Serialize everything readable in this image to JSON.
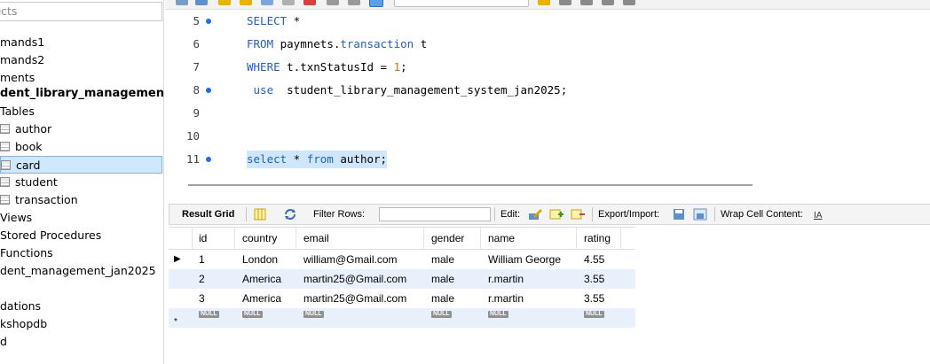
{
  "sidebar": {
    "filter_text": "jects",
    "rows": [
      {
        "label": "mands1",
        "icon": "",
        "style": "normal"
      },
      {
        "label": "mands2",
        "icon": "",
        "style": "normal"
      },
      {
        "label": "ments",
        "icon": "",
        "style": "normal"
      },
      {
        "label": "dent_library_management",
        "icon": "",
        "style": "bold"
      },
      {
        "label": "Tables",
        "icon": "",
        "style": "normal"
      },
      {
        "label": "author",
        "icon": "table-icon",
        "style": "normal"
      },
      {
        "label": "book",
        "icon": "table-icon",
        "style": "normal"
      },
      {
        "label": "card",
        "icon": "table-icon",
        "style": "selected"
      },
      {
        "label": "student",
        "icon": "table-icon",
        "style": "normal"
      },
      {
        "label": "transaction",
        "icon": "table-icon",
        "style": "normal"
      },
      {
        "label": "Views",
        "icon": "",
        "style": "normal"
      },
      {
        "label": "Stored Procedures",
        "icon": "",
        "style": "normal"
      },
      {
        "label": "Functions",
        "icon": "",
        "style": "normal"
      },
      {
        "label": "dent_management_jan2025",
        "icon": "",
        "style": "normal"
      },
      {
        "label": "",
        "icon": "",
        "style": "normal"
      },
      {
        "label": "dations",
        "icon": "",
        "style": "normal"
      },
      {
        "label": "kshopdb",
        "icon": "",
        "style": "normal"
      },
      {
        "label": "d",
        "icon": "",
        "style": "normal"
      }
    ]
  },
  "editor": {
    "lines": [
      {
        "num": "5",
        "dot": true,
        "tokens": [
          {
            "t": "SELECT",
            "c": "kw"
          },
          {
            "t": " *",
            "c": ""
          }
        ]
      },
      {
        "num": "6",
        "dot": false,
        "tokens": [
          {
            "t": "FROM",
            "c": "kw"
          },
          {
            "t": " paymnets.",
            "c": ""
          },
          {
            "t": "transaction",
            "c": "kw"
          },
          {
            "t": " t",
            "c": ""
          }
        ]
      },
      {
        "num": "7",
        "dot": false,
        "tokens": [
          {
            "t": "WHERE",
            "c": "kw"
          },
          {
            "t": " t.txnStatusId = ",
            "c": ""
          },
          {
            "t": "1",
            "c": "num"
          },
          {
            "t": ";",
            "c": ""
          }
        ]
      },
      {
        "num": "8",
        "dot": true,
        "tokens": [
          {
            "t": " use",
            "c": "kw"
          },
          {
            "t": "  student_library_management_system_jan2025;",
            "c": ""
          }
        ]
      },
      {
        "num": "9",
        "dot": false,
        "tokens": []
      },
      {
        "num": "10",
        "dot": false,
        "tokens": []
      },
      {
        "num": "11",
        "dot": true,
        "highlight": true,
        "tokens": [
          {
            "t": "select",
            "c": "kw"
          },
          {
            "t": " * ",
            "c": ""
          },
          {
            "t": "from",
            "c": "kw"
          },
          {
            "t": " author;",
            "c": ""
          }
        ]
      }
    ]
  },
  "result_toolbar": {
    "result_grid_label": "Result Grid",
    "filter_rows_label": "Filter Rows:",
    "filter_value": "",
    "edit_label": "Edit:",
    "export_label": "Export/Import:",
    "wrap_label": "Wrap Cell Content:"
  },
  "grid": {
    "columns": [
      "id",
      "country",
      "email",
      "gender",
      "name",
      "rating"
    ],
    "rows": [
      {
        "id": "1",
        "country": "London",
        "email": "william@Gmail.com",
        "gender": "male",
        "name": "William George",
        "rating": "4.55"
      },
      {
        "id": "2",
        "country": "America",
        "email": "martin25@Gmail.com",
        "gender": "male",
        "name": "r.martin",
        "rating": "3.55"
      },
      {
        "id": "3",
        "country": "America",
        "email": "martin25@Gmail.com",
        "gender": "male",
        "name": "r.martin",
        "rating": "3.55"
      }
    ],
    "null_label": "NULL",
    "current_row_marker": "▶",
    "new_row_marker": "*"
  },
  "colors": {
    "keyword": "#1f5fd0",
    "number": "#e07000",
    "selection": "#cde8ff",
    "line_highlight": "#cfe6fb",
    "alt_row": "#e7f0fb"
  }
}
